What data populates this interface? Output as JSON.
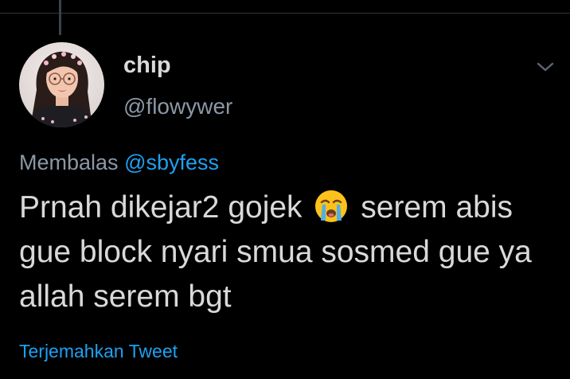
{
  "tweet": {
    "author": {
      "display_name": "chip",
      "handle": "@flowywer",
      "avatar_icon": "avatar-photo-icon"
    },
    "reply": {
      "prefix": "Membalas",
      "mention": "@sbyfess"
    },
    "text": {
      "part1": "Prnah dikejar2 gojek",
      "emoji": "loudly-crying-face-icon",
      "part2": "serem abis gue block nyari smua sosmed gue ya allah serem bgt"
    },
    "translate_label": "Terjemahkan Tweet",
    "menu_icon": "chevron-down-icon"
  },
  "colors": {
    "background": "#000000",
    "text_primary": "#d9d9d9",
    "text_secondary": "#8b98a5",
    "accent": "#1da1f2"
  }
}
